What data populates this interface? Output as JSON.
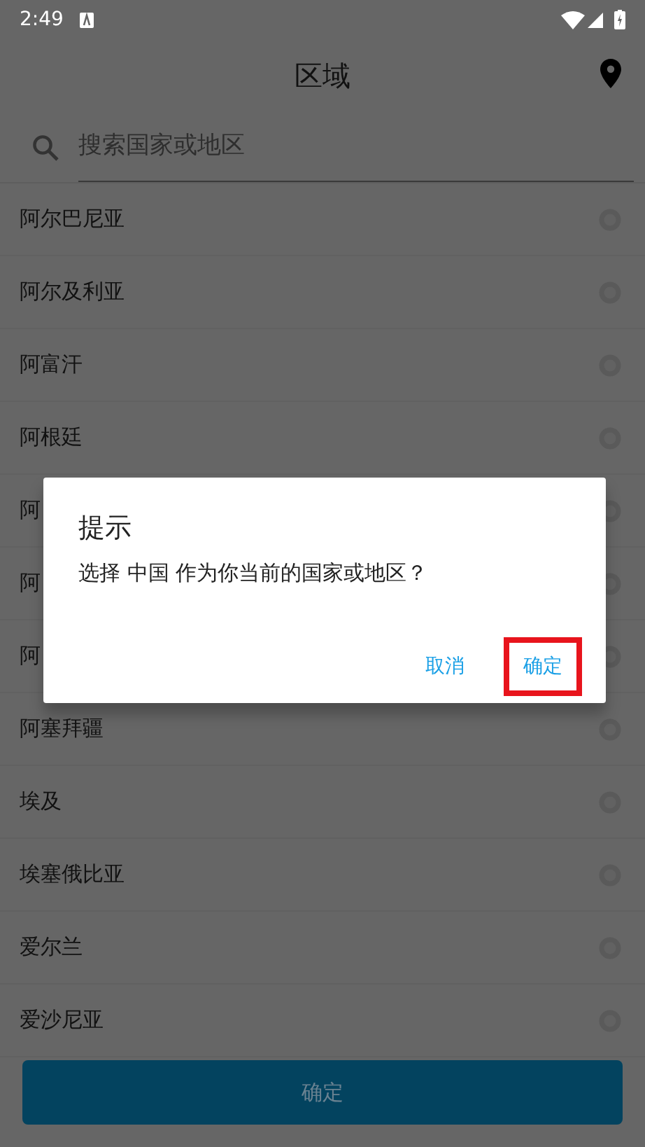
{
  "status_bar": {
    "time": "2:49"
  },
  "header": {
    "title": "区域"
  },
  "search": {
    "placeholder": "搜索国家或地区"
  },
  "countries": [
    {
      "name": "阿尔巴尼亚",
      "selected": false
    },
    {
      "name": "阿尔及利亚",
      "selected": false
    },
    {
      "name": "阿富汗",
      "selected": false
    },
    {
      "name": "阿根廷",
      "selected": false
    },
    {
      "name": "阿",
      "selected": false
    },
    {
      "name": "阿",
      "selected": false
    },
    {
      "name": "阿",
      "selected": false
    },
    {
      "name": "阿塞拜疆",
      "selected": false
    },
    {
      "name": "埃及",
      "selected": false
    },
    {
      "name": "埃塞俄比亚",
      "selected": false
    },
    {
      "name": "爱尔兰",
      "selected": false
    },
    {
      "name": "爱沙尼亚",
      "selected": false
    }
  ],
  "confirm_button": {
    "label": "确定"
  },
  "dialog": {
    "title": "提示",
    "message": "选择 中国 作为你当前的国家或地区？",
    "buttons": [
      {
        "label": "取消",
        "highlighted": false
      },
      {
        "label": "确定",
        "highlighted": true
      }
    ]
  }
}
